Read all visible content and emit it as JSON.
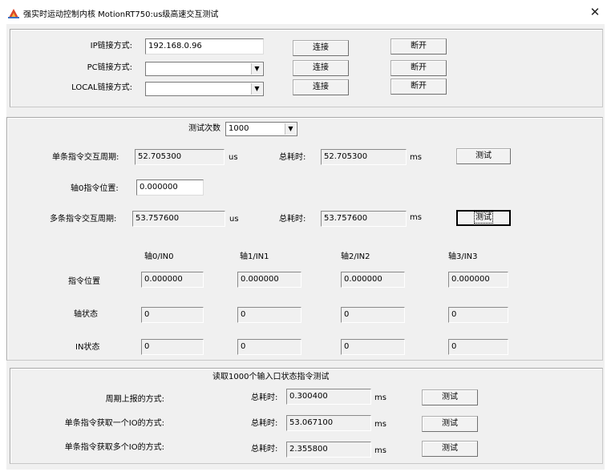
{
  "window": {
    "title": "强实时运动控制内核 MotionRT750:us级高速交互测试",
    "close_glyph": "✕",
    "icon": "app-icon"
  },
  "connect": {
    "ip_label": "IP链接方式:",
    "ip_value": "192.168.0.96",
    "pc_label": "PC链接方式:",
    "pc_value": "",
    "local_label": "LOCAL链接方式:",
    "local_value": "",
    "connect_label": "连接",
    "disconnect_label": "断开"
  },
  "test": {
    "count_label": "测试次数",
    "count_value": "1000",
    "single_label": "单条指令交互周期:",
    "single_value": "52.705300",
    "single_unit": "us",
    "single_total_label": "总耗时:",
    "single_total_value": "52.705300",
    "single_total_unit": "ms",
    "test_label": "测试",
    "axis0_pos_label": "轴0指令位置:",
    "axis0_pos_value": "0.000000",
    "multi_label": "多条指令交互周期:",
    "multi_value": "53.757600",
    "multi_unit": "us",
    "multi_total_label": "总耗时:",
    "multi_total_value": "53.757600",
    "multi_total_unit": "ms"
  },
  "axes": {
    "headers": [
      "轴0/IN0",
      "轴1/IN1",
      "轴2/IN2",
      "轴3/IN3"
    ],
    "row_pos_label": "指令位置",
    "row_state_label": "轴状态",
    "row_in_label": "IN状态",
    "pos_values": [
      "0.000000",
      "0.000000",
      "0.000000",
      "0.000000"
    ],
    "state_values": [
      "0",
      "0",
      "0",
      "0"
    ],
    "in_values": [
      "0",
      "0",
      "0",
      "0"
    ]
  },
  "io": {
    "title": "读取1000个输入口状态指令测试",
    "total_label": "总耗时:",
    "unit": "ms",
    "test_label": "测试",
    "rows": [
      {
        "label": "周期上报的方式:",
        "value": "0.300400"
      },
      {
        "label": "单条指令获取一个IO的方式:",
        "value": "53.067100"
      },
      {
        "label": "单条指令获取多个IO的方式:",
        "value": "2.355800"
      }
    ]
  }
}
